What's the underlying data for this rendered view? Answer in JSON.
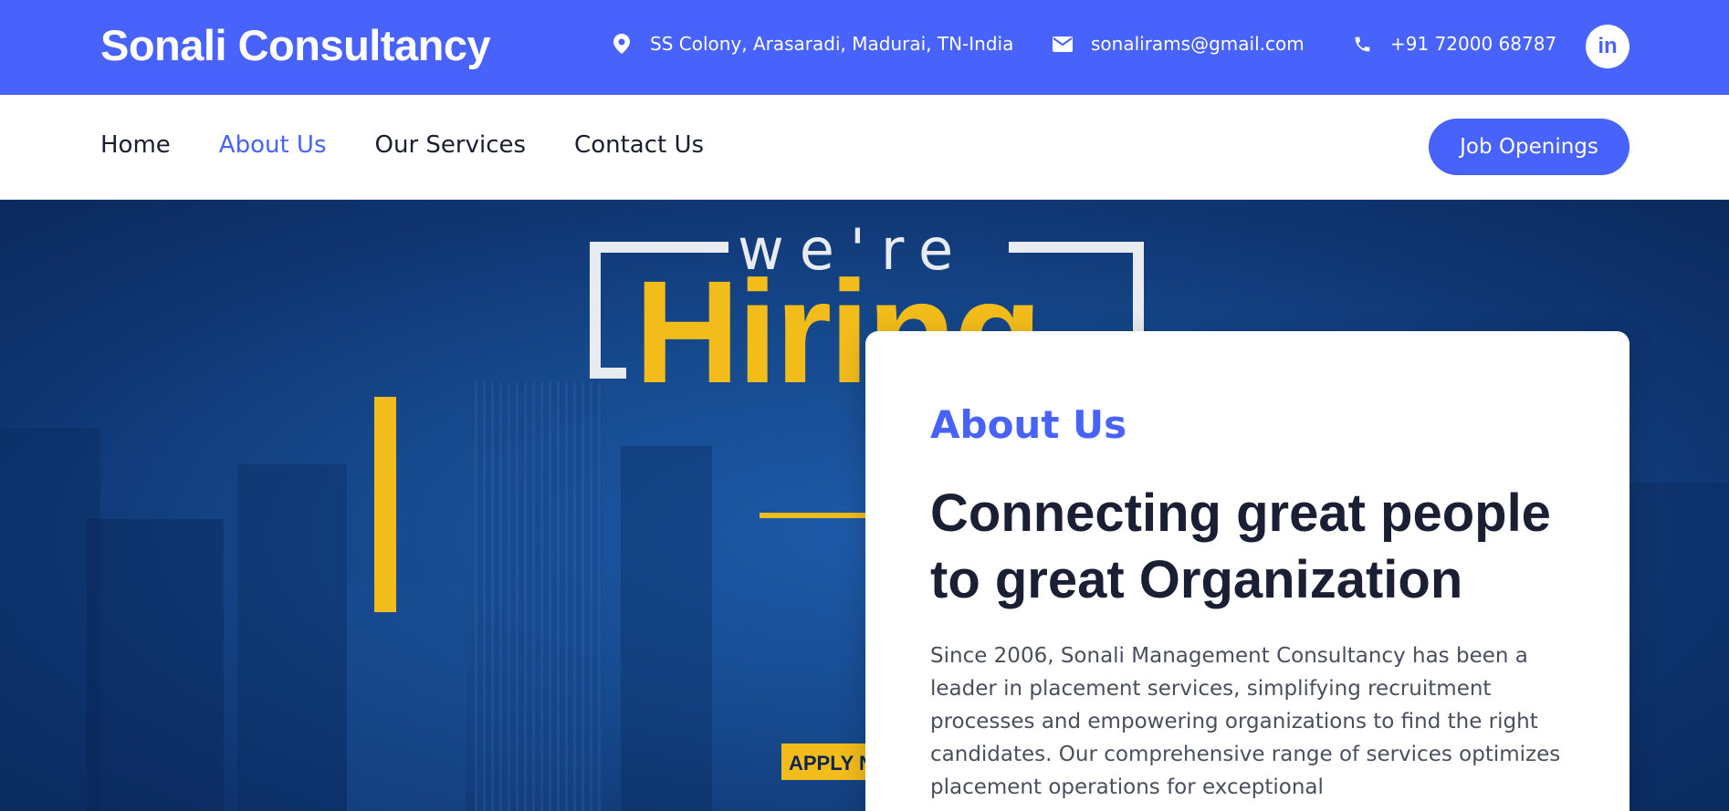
{
  "topbar": {
    "brand": "Sonali Consultancy",
    "address": "SS Colony, Arasaradi, Madurai, TN-India",
    "email": "sonalirams@gmail.com",
    "phone": "+91 72000 68787",
    "social_linkedin": "in",
    "background_color": "#4862fc"
  },
  "nav": {
    "items": [
      {
        "label": "Home",
        "active": false
      },
      {
        "label": "About Us",
        "active": true
      },
      {
        "label": "Our Services",
        "active": false
      },
      {
        "label": "Contact Us",
        "active": false
      }
    ],
    "cta_label": "Job Openings",
    "accent_color": "#4862fc"
  },
  "hero": {
    "banner_were": "we're",
    "banner_hiring": "Hiring",
    "banner_apply": "APPLY N",
    "highlight_color": "#f2bc1b"
  },
  "about": {
    "eyebrow": "About Us",
    "heading": "Connecting great people to great Organization",
    "body": "Since 2006, Sonali Management Consultancy has been a leader in placement services, simplifying recruitment processes and empowering organizations to find the right candidates. Our comprehensive range of services optimizes placement operations for exceptional"
  },
  "icons": {
    "address": "map-pin-icon",
    "email": "envelope-icon",
    "phone": "phone-icon",
    "social": "linkedin-icon"
  }
}
